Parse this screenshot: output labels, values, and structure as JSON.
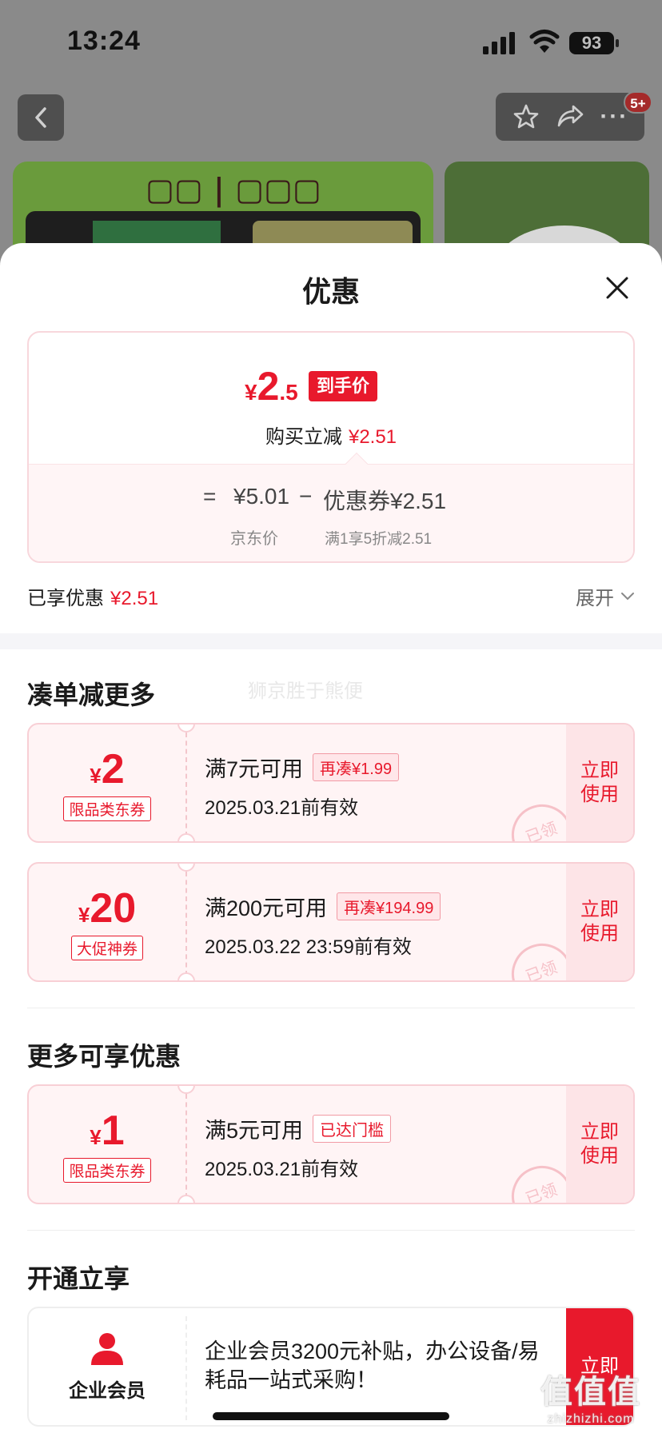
{
  "status_bar": {
    "time": "13:24",
    "battery": "93"
  },
  "header": {
    "notification_badge": "5+"
  },
  "sheet": {
    "title": "优惠",
    "price_card": {
      "currency": "¥",
      "price_int": "2",
      "price_dec": ".5",
      "final_tag": "到手价",
      "instant_label": "购买立减",
      "instant_amount": "¥2.51",
      "eq": "=",
      "jd_price": "¥5.01",
      "minus": "−",
      "coupon_value": "优惠券¥2.51",
      "jd_price_label": "京东价",
      "coupon_desc": "满1享5折减2.51"
    },
    "enjoyed": {
      "label": "已享优惠",
      "amount": "¥2.51",
      "expand": "展开"
    },
    "section1_title": "凑单减更多",
    "watermark_text": "狮京胜于熊便",
    "coupons_more": [
      {
        "yen": "¥",
        "amount": "2",
        "kind": "限品类东券",
        "condition": "满7元可用",
        "tag": "再凑¥1.99",
        "valid": "2025.03.21前有效",
        "use": "立即使用",
        "stamp": "已领"
      },
      {
        "yen": "¥",
        "amount": "20",
        "kind": "大促神券",
        "condition": "满200元可用",
        "tag": "再凑¥194.99",
        "valid": "2025.03.22 23:59前有效",
        "use": "立即使用",
        "stamp": "已领"
      }
    ],
    "section2_title": "更多可享优惠",
    "coupons_extra": [
      {
        "yen": "¥",
        "amount": "1",
        "kind": "限品类东券",
        "condition": "满5元可用",
        "tag": "已达门槛",
        "valid": "2025.03.21前有效",
        "use": "立即使用",
        "stamp": "已领"
      }
    ],
    "section3_title": "开通立享",
    "member": {
      "name": "企业会员",
      "desc": "企业会员3200元补贴，办公设备/易耗品一站式采购！",
      "open": "立即"
    }
  },
  "site_watermark": {
    "big": "值值值",
    "small": "zhizhizhi.com"
  },
  "colors": {
    "brand_red": "#e8192c",
    "coupon_bg": "#fff4f5"
  }
}
